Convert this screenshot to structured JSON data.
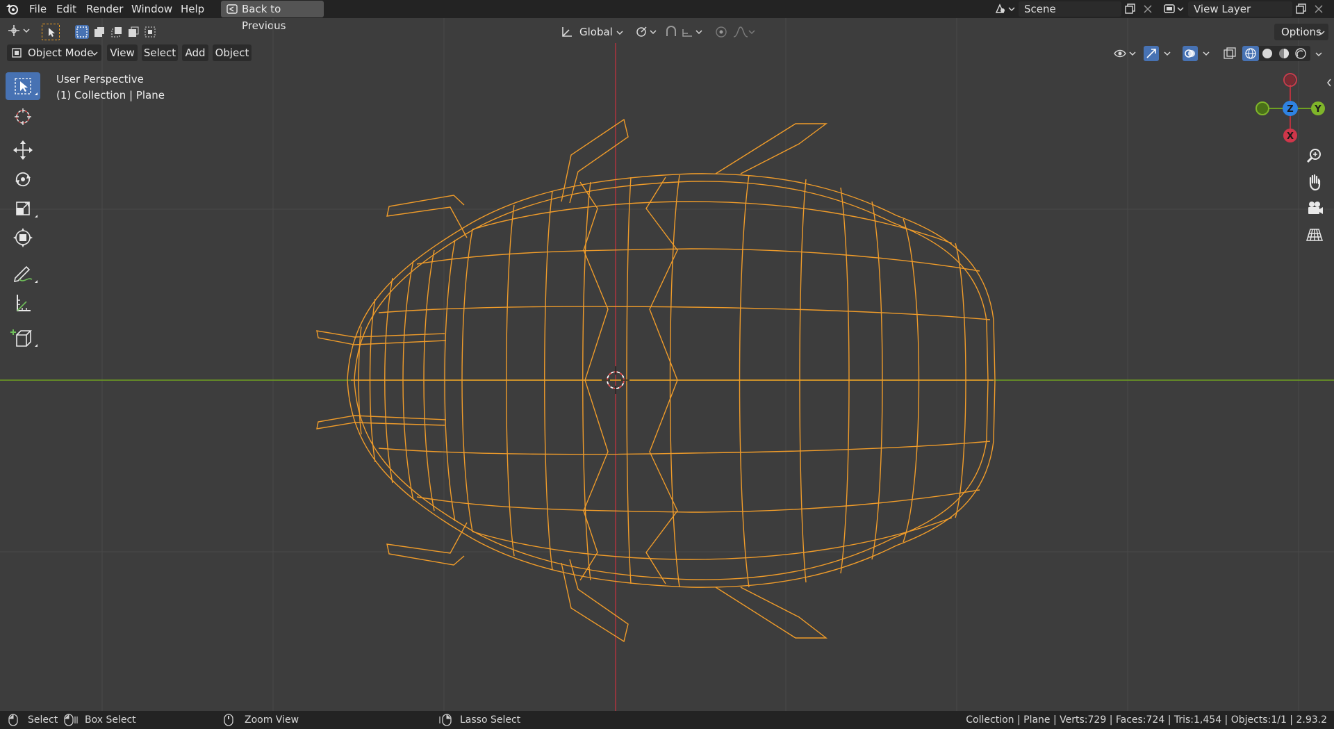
{
  "topbar": {
    "menus": [
      "File",
      "Edit",
      "Render",
      "Window",
      "Help"
    ],
    "back_button": "Back to Previous",
    "scene": "Scene",
    "view_layer": "View Layer"
  },
  "tool_header": {
    "orientation": "Global",
    "options": "Options"
  },
  "viewport_header": {
    "mode": "Object Mode",
    "menus": [
      "View",
      "Select",
      "Add",
      "Object"
    ]
  },
  "viewport": {
    "perspective": "User Perspective",
    "collection_info": "(1) Collection | Plane",
    "gizmo": {
      "z": "Z",
      "y": "Y",
      "x": "X"
    }
  },
  "statusbar": {
    "select": "Select",
    "box_select": "Box Select",
    "zoom_view": "Zoom View",
    "lasso_select": "Lasso Select",
    "stats": "Collection | Plane | Verts:729 | Faces:724 | Tris:1,454 | Objects:1/1 | 2.93.2"
  },
  "colors": {
    "accent": "#4772b3",
    "wire_selected": "#f09c2a",
    "axis_x": "#b5343f",
    "axis_y": "#6ea021",
    "axis_z": "#2f83e3"
  }
}
